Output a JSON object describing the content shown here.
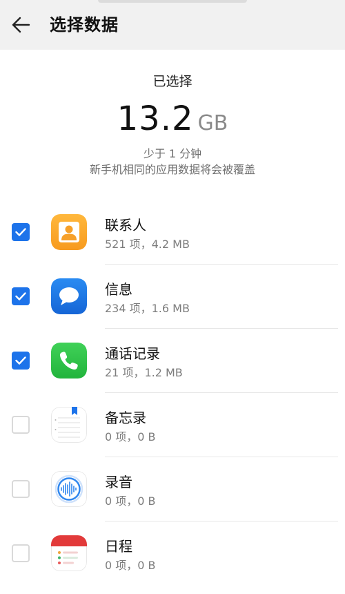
{
  "header": {
    "title": "选择数据",
    "back_icon": "arrow-left-icon"
  },
  "summary": {
    "label": "已选择",
    "size_value": "13.2",
    "size_unit": "GB",
    "time_estimate": "少于 1 分钟",
    "note": "新手机相同的应用数据将会被覆盖"
  },
  "items": [
    {
      "name": "联系人",
      "meta": "521 项，4.2 MB",
      "checked": true,
      "icon": "contacts-icon"
    },
    {
      "name": "信息",
      "meta": "234 项，1.6 MB",
      "checked": true,
      "icon": "messages-icon"
    },
    {
      "name": "通话记录",
      "meta": "21 项，1.2 MB",
      "checked": true,
      "icon": "call-log-icon"
    },
    {
      "name": "备忘录",
      "meta": "0 项，0 B",
      "checked": false,
      "icon": "notes-icon"
    },
    {
      "name": "录音",
      "meta": "0 项，0 B",
      "checked": false,
      "icon": "recorder-icon"
    },
    {
      "name": "日程",
      "meta": "0 项，0 B",
      "checked": false,
      "icon": "calendar-icon"
    }
  ],
  "colors": {
    "accent": "#1d73ea",
    "header_bg": "#f1f1f1",
    "secondary_text": "#7d7d7d"
  }
}
